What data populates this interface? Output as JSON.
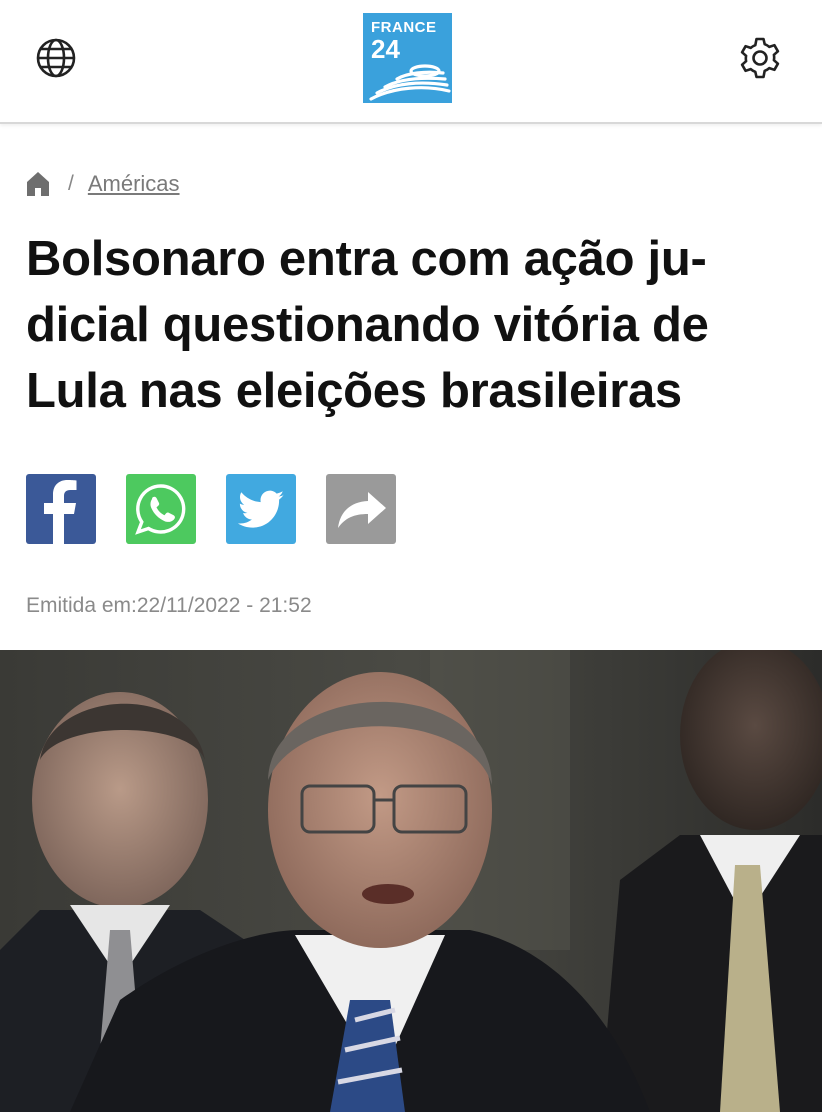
{
  "header": {
    "logo_line1": "FRANCE",
    "logo_line2": "24",
    "globe_icon": "globe-icon",
    "settings_icon": "gear-icon"
  },
  "breadcrumb": {
    "home_icon": "home-icon",
    "separator": "/",
    "section": "Américas"
  },
  "article": {
    "title": "Bolsonaro entra com ação ju-dicial questionando vitória de Lula nas eleições brasileiras",
    "published": "Emitida em:22/11/2022 - 21:52"
  },
  "share": {
    "buttons": [
      {
        "name": "facebook",
        "icon": "facebook-icon",
        "color": "#3b5998"
      },
      {
        "name": "whatsapp",
        "icon": "whatsapp-icon",
        "color": "#4dc95f"
      },
      {
        "name": "twitter",
        "icon": "twitter-icon",
        "color": "#41a9e0"
      },
      {
        "name": "share",
        "icon": "share-arrow-icon",
        "color": "#9a9a9a"
      }
    ]
  },
  "photo": {
    "subject": "man in suit and glasses speaking, with men in suits behind him"
  },
  "colors": {
    "brand": "#3aa1dc",
    "text": "#111111",
    "muted": "#8a8a8a"
  }
}
